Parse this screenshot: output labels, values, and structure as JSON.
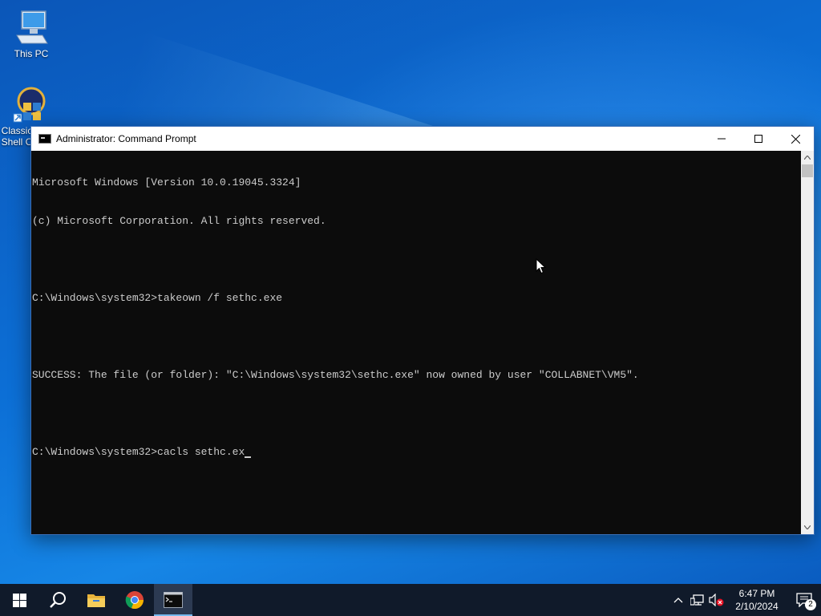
{
  "desktop": {
    "icons": [
      {
        "label": "This PC",
        "icon": "computer-icon"
      },
      {
        "label": "Classic Shell C",
        "icon": "classic-shell-icon"
      }
    ]
  },
  "window": {
    "title": "Administrator: Command Prompt",
    "icon": "cmd-icon",
    "console_lines": [
      "Microsoft Windows [Version 10.0.19045.3324]",
      "(c) Microsoft Corporation. All rights reserved.",
      "",
      "C:\\Windows\\system32>takeown /f sethc.exe",
      "",
      "SUCCESS: The file (or folder): \"C:\\Windows\\system32\\sethc.exe\" now owned by user \"COLLABNET\\VM5\".",
      "",
      "C:\\Windows\\system32>cacls sethc.ex"
    ],
    "background": "#0c0c0c",
    "text_color": "#cccccc"
  },
  "taskbar": {
    "apps": [
      {
        "name": "start",
        "icon": "windows-logo-icon"
      },
      {
        "name": "search",
        "icon": "search-icon"
      },
      {
        "name": "file-explorer",
        "icon": "folder-icon"
      },
      {
        "name": "chrome",
        "icon": "chrome-icon"
      },
      {
        "name": "command-prompt",
        "icon": "cmd-icon",
        "active": true
      }
    ],
    "tray": {
      "time": "6:47 PM",
      "date": "2/10/2024",
      "notification_count": "2"
    },
    "accent": "#76b9ed"
  }
}
